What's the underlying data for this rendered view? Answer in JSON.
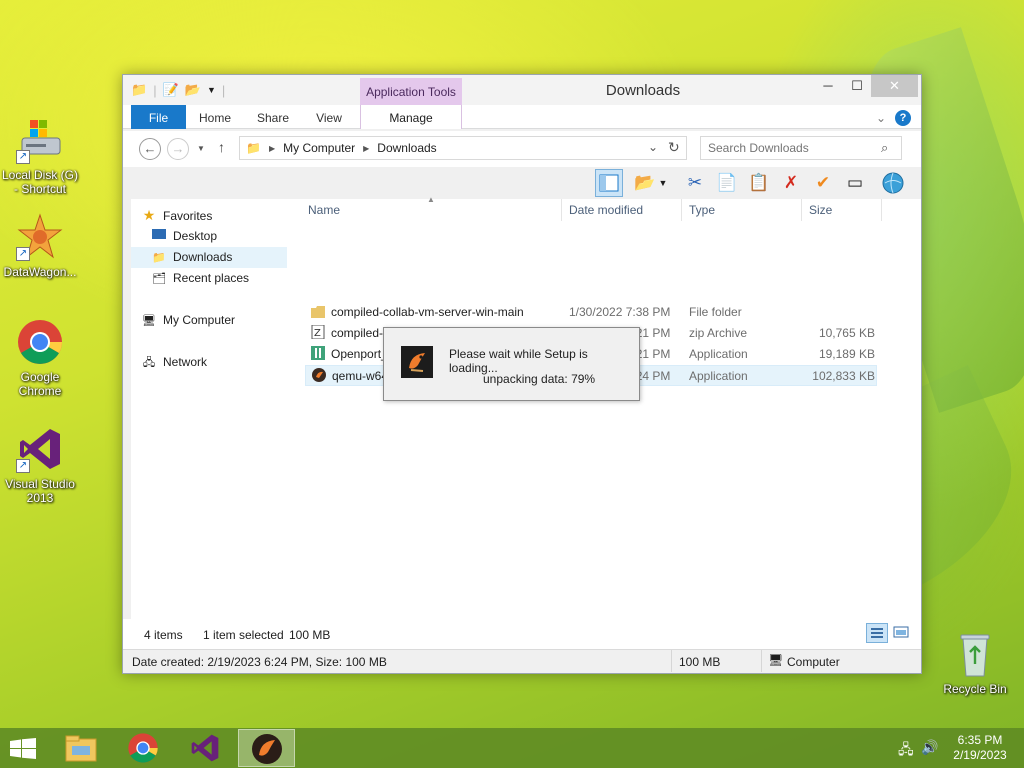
{
  "desktop": {
    "icons": [
      {
        "label": "Local Disk (G) - Shortcut",
        "icon": "drive-icon"
      },
      {
        "label": "DataWagon...",
        "icon": "datawagon-icon"
      },
      {
        "label": "Google Chrome",
        "icon": "chrome-icon"
      },
      {
        "label": "Visual Studio 2013",
        "icon": "visual-studio-icon"
      },
      {
        "label": "Recycle Bin",
        "icon": "recycle-bin-icon"
      }
    ]
  },
  "window": {
    "title": "Downloads",
    "contextual_group": "Application Tools",
    "tabs": {
      "file": "File",
      "home": "Home",
      "share": "Share",
      "view": "View",
      "manage": "Manage"
    },
    "address": {
      "root": "My Computer",
      "current": "Downloads"
    },
    "search": {
      "placeholder": "Search Downloads"
    },
    "nav": {
      "favorites": "Favorites",
      "desktop": "Desktop",
      "downloads": "Downloads",
      "recent": "Recent places",
      "computer": "My Computer",
      "network": "Network"
    },
    "columns": {
      "name": "Name",
      "date": "Date modified",
      "type": "Type",
      "size": "Size"
    },
    "files": [
      {
        "name": "compiled-collab-vm-server-win-main",
        "date": "1/30/2022 7:38 PM",
        "type": "File folder",
        "size": ""
      },
      {
        "name": "compiled-collab-vm-server-win-main",
        "date": "2/19/2023 6:21 PM",
        "type": "zip Archive",
        "size": "10,765 KB"
      },
      {
        "name": "Openport_2.1.0",
        "date": "2/19/2023 6:21 PM",
        "type": "Application",
        "size": "19,189 KB"
      },
      {
        "name": "qemu-w64-setup-20181128",
        "date": "2/19/2023 6:24 PM",
        "type": "Application",
        "size": "102,833 KB"
      }
    ],
    "status": {
      "items": "4 items",
      "selected": "1 item selected",
      "selected_size": "100 MB",
      "details": "Date created: 2/19/2023 6:24 PM, Size: 100 MB",
      "total_size": "100 MB",
      "location": "Computer"
    }
  },
  "setup_dialog": {
    "message": "Please wait while Setup is loading...",
    "progress": "unpacking data: 79%"
  },
  "taskbar": {
    "time": "6:35 PM",
    "date": "2/19/2023"
  },
  "colors": {
    "accent": "#1979ca",
    "contextual": "#e4c8ec",
    "selection": "#e5f3fb"
  }
}
